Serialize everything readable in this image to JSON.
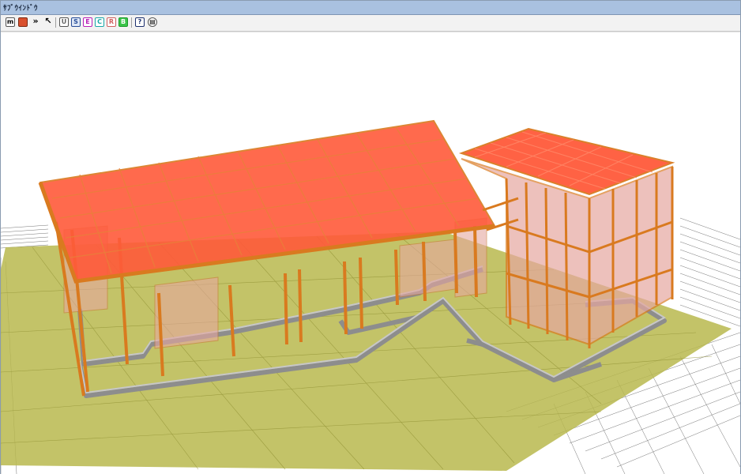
{
  "window": {
    "title": "ｻﾌﾞｳｲﾝﾄﾞｳ"
  },
  "toolbar": {
    "buttons": [
      {
        "id": "model",
        "glyph": "m",
        "icon": "model-icon"
      },
      {
        "id": "shaded",
        "glyph": "",
        "icon": "shaded-solid-icon",
        "color": "#d9502e"
      },
      {
        "id": "forward",
        "glyph": "»",
        "icon": "double-chevron-icon"
      },
      {
        "id": "pointer",
        "glyph": "↖",
        "icon": "pointer-icon"
      },
      {
        "id": "view-u",
        "glyph": "U",
        "icon": "view-u-icon",
        "color": "#666666"
      },
      {
        "id": "view-s",
        "glyph": "S",
        "icon": "view-s-icon",
        "color": "#2a4f9a"
      },
      {
        "id": "view-e",
        "glyph": "E",
        "icon": "view-e-icon",
        "color": "#b81fb8"
      },
      {
        "id": "view-c",
        "glyph": "C",
        "icon": "view-c-icon",
        "color": "#1aa8a8"
      },
      {
        "id": "view-r",
        "glyph": "R",
        "icon": "view-r-icon",
        "color": "#d06060"
      },
      {
        "id": "view-g",
        "glyph": "B",
        "icon": "view-b-icon",
        "color": "#1b9a2a"
      },
      {
        "id": "help",
        "glyph": "?",
        "icon": "help-icon",
        "color": "#1b2f6e"
      },
      {
        "id": "print",
        "glyph": "▤",
        "icon": "print-icon"
      }
    ]
  },
  "colors": {
    "ground": "#b8b94e",
    "roof": "#ff5a3a",
    "frame": "#d97a1f",
    "wall": "#e6a7a0",
    "foundation": "#a0a0a0"
  }
}
